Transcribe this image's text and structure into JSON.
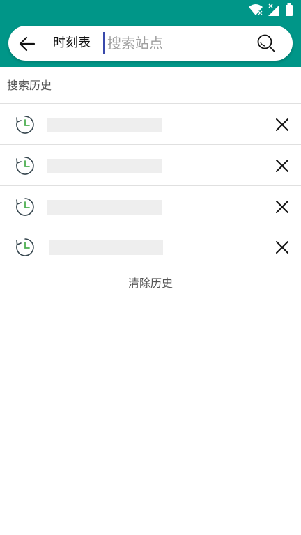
{
  "header": {
    "title": "时刻表",
    "search_placeholder": "搜索站点",
    "search_value": ""
  },
  "status_bar": {
    "icons": [
      "wifi-icon",
      "signal-icon",
      "battery-icon"
    ]
  },
  "history": {
    "section_label": "搜索历史",
    "items": [
      {
        "text": ""
      },
      {
        "text": ""
      },
      {
        "text": ""
      },
      {
        "text": ""
      }
    ],
    "clear_label": "清除历史"
  },
  "colors": {
    "primary": "#009688",
    "clock_face": "#37474f",
    "clock_hands": "#4caf50",
    "cursor": "#3949ab"
  },
  "icons": {
    "back": "arrow-left-icon",
    "search": "magnifier-icon",
    "history": "clock-history-icon",
    "delete": "close-icon"
  }
}
